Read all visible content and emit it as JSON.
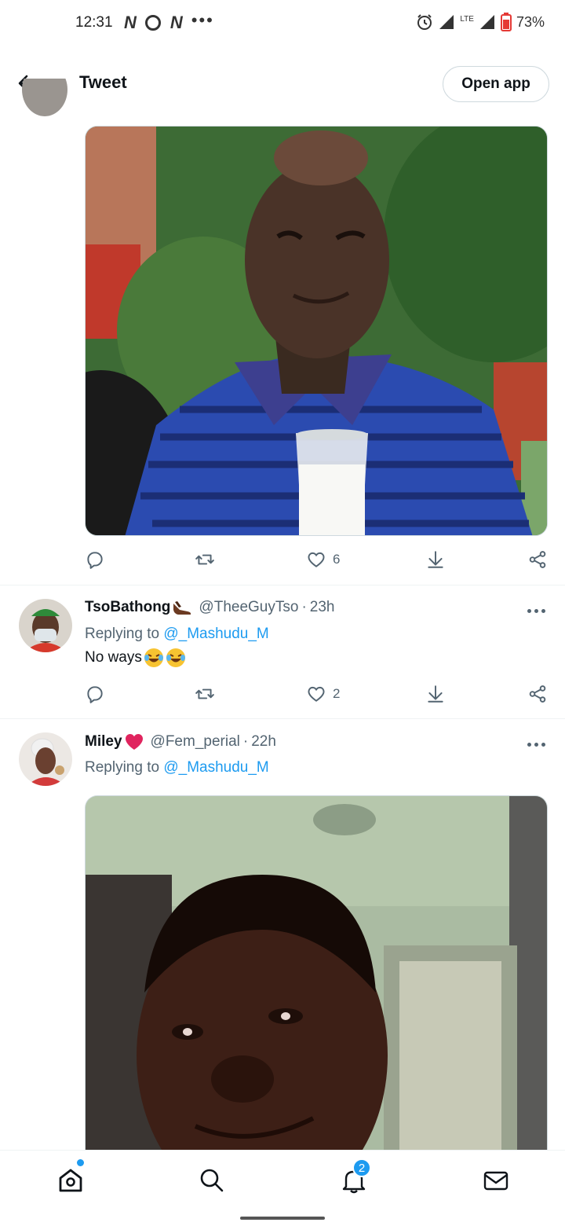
{
  "status_bar": {
    "time": "12:31",
    "battery": "73%",
    "network": "LTE"
  },
  "header": {
    "title": "Tweet",
    "open_app_label": "Open app"
  },
  "main_tweet": {
    "likes": "6"
  },
  "replies": [
    {
      "name": "TsoBathong",
      "handle": "@TheeGuyTso",
      "separator": "·",
      "time": "23h",
      "replying_prefix": "Replying to",
      "replying_to": "@_Mashudu_M",
      "text": "No ways",
      "likes": "2"
    },
    {
      "name": "Miley",
      "handle": "@Fem_perial",
      "separator": "·",
      "time": "22h",
      "replying_prefix": "Replying to",
      "replying_to": "@_Mashudu_M"
    }
  ],
  "bottom_nav": {
    "notifications_badge": "2"
  },
  "icons": {
    "back": "arrow-left-icon",
    "reply": "reply-icon",
    "retweet": "retweet-icon",
    "like": "heart-icon",
    "download": "download-icon",
    "share": "share-icon",
    "more": "more-icon",
    "home": "home-icon",
    "search": "search-icon",
    "notifications": "bell-icon",
    "messages": "mail-icon"
  },
  "colors": {
    "accent": "#1d9bf0",
    "text_primary": "#0f1419",
    "text_secondary": "#536471",
    "heart_red": "#e0245e"
  }
}
